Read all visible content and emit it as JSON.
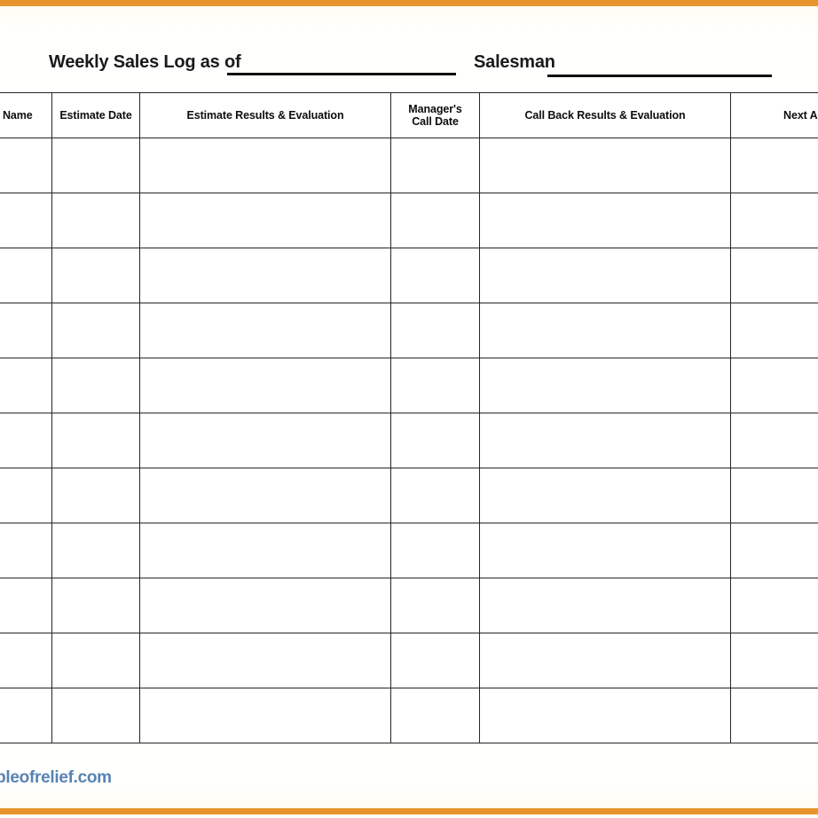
{
  "page": {
    "accent_color": "#e8942c",
    "ink_color": "#1a1a1a",
    "watermark_color": "#3b6ea5"
  },
  "header": {
    "title_label": "Weekly Sales Log as of",
    "salesman_label": "Salesman"
  },
  "table": {
    "columns": [
      {
        "label": "Customer's Name",
        "cropped": "left"
      },
      {
        "label": "Estimate Date",
        "cropped": "none"
      },
      {
        "label": "Estimate Results & Evaluation",
        "cropped": "none"
      },
      {
        "label": "Manager's\nCall Date",
        "line1": "Manager's",
        "line2": "Call Date",
        "cropped": "none"
      },
      {
        "label": "Call Back Results & Evaluation",
        "cropped": "none"
      },
      {
        "label": "Next Action",
        "cropped": "right"
      }
    ],
    "row_count": 11,
    "rows": [
      {
        "name": "",
        "estimate_date": "",
        "estimate_results": "",
        "manager_call_date": "",
        "call_back_results": "",
        "next_action": ""
      },
      {
        "name": "",
        "estimate_date": "",
        "estimate_results": "",
        "manager_call_date": "",
        "call_back_results": "",
        "next_action": ""
      },
      {
        "name": "",
        "estimate_date": "",
        "estimate_results": "",
        "manager_call_date": "",
        "call_back_results": "",
        "next_action": ""
      },
      {
        "name": "",
        "estimate_date": "",
        "estimate_results": "",
        "manager_call_date": "",
        "call_back_results": "",
        "next_action": ""
      },
      {
        "name": "",
        "estimate_date": "",
        "estimate_results": "",
        "manager_call_date": "",
        "call_back_results": "",
        "next_action": ""
      },
      {
        "name": "",
        "estimate_date": "",
        "estimate_results": "",
        "manager_call_date": "",
        "call_back_results": "",
        "next_action": ""
      },
      {
        "name": "",
        "estimate_date": "",
        "estimate_results": "",
        "manager_call_date": "",
        "call_back_results": "",
        "next_action": ""
      },
      {
        "name": "",
        "estimate_date": "",
        "estimate_results": "",
        "manager_call_date": "",
        "call_back_results": "",
        "next_action": ""
      },
      {
        "name": "",
        "estimate_date": "",
        "estimate_results": "",
        "manager_call_date": "",
        "call_back_results": "",
        "next_action": ""
      },
      {
        "name": "",
        "estimate_date": "",
        "estimate_results": "",
        "manager_call_date": "",
        "call_back_results": "",
        "next_action": ""
      },
      {
        "name": "",
        "estimate_date": "",
        "estimate_results": "",
        "manager_call_date": "",
        "call_back_results": "",
        "next_action": ""
      }
    ]
  },
  "footer": {
    "watermark": "sampleofrelief.com"
  }
}
